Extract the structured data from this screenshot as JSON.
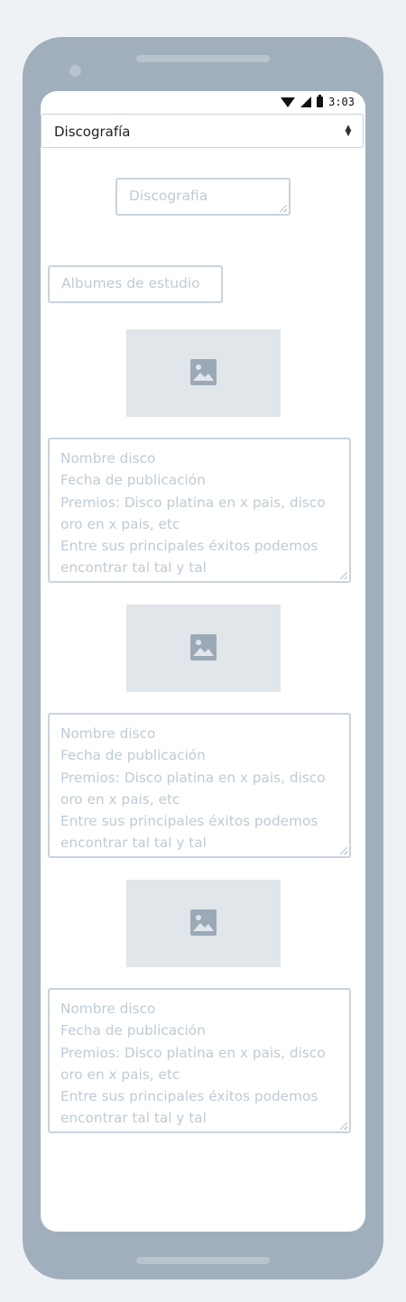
{
  "status_bar": {
    "time": "3:03"
  },
  "section_select": {
    "selected": "Discografía"
  },
  "title_field": {
    "placeholder": "Discografia"
  },
  "category_field": {
    "placeholder": "Albumes de estudio"
  },
  "albums": [
    {
      "image": "image-placeholder-icon",
      "description_lines": [
        "Nombre disco",
        "Fecha de publicación",
        "Premios: Disco platina en x pais, disco",
        "oro en x pais, etc",
        "Entre sus principales éxitos podemos",
        "encontrar tal tal y tal"
      ]
    },
    {
      "image": "image-placeholder-icon",
      "description_lines": [
        "Nombre disco",
        "Fecha de publicación",
        "Premios: Disco platina en x pais, disco",
        "oro en x pais, etc",
        "Entre sus principales éxitos podemos",
        "encontrar tal tal y tal"
      ]
    },
    {
      "image": "image-placeholder-icon",
      "description_lines": [
        "Nombre disco",
        "Fecha de publicación",
        "Premios: Disco platina en x pais, disco",
        "oro en x pais, etc",
        "Entre sus principales éxitos podemos",
        "encontrar tal tal y tal"
      ]
    }
  ],
  "colors": {
    "device_frame": "#a0afbb",
    "screen": "#ffffff",
    "placeholder_text": "#bfcbd5",
    "image_placeholder": "#e1e6ea",
    "icon": "#9aa9b5"
  }
}
